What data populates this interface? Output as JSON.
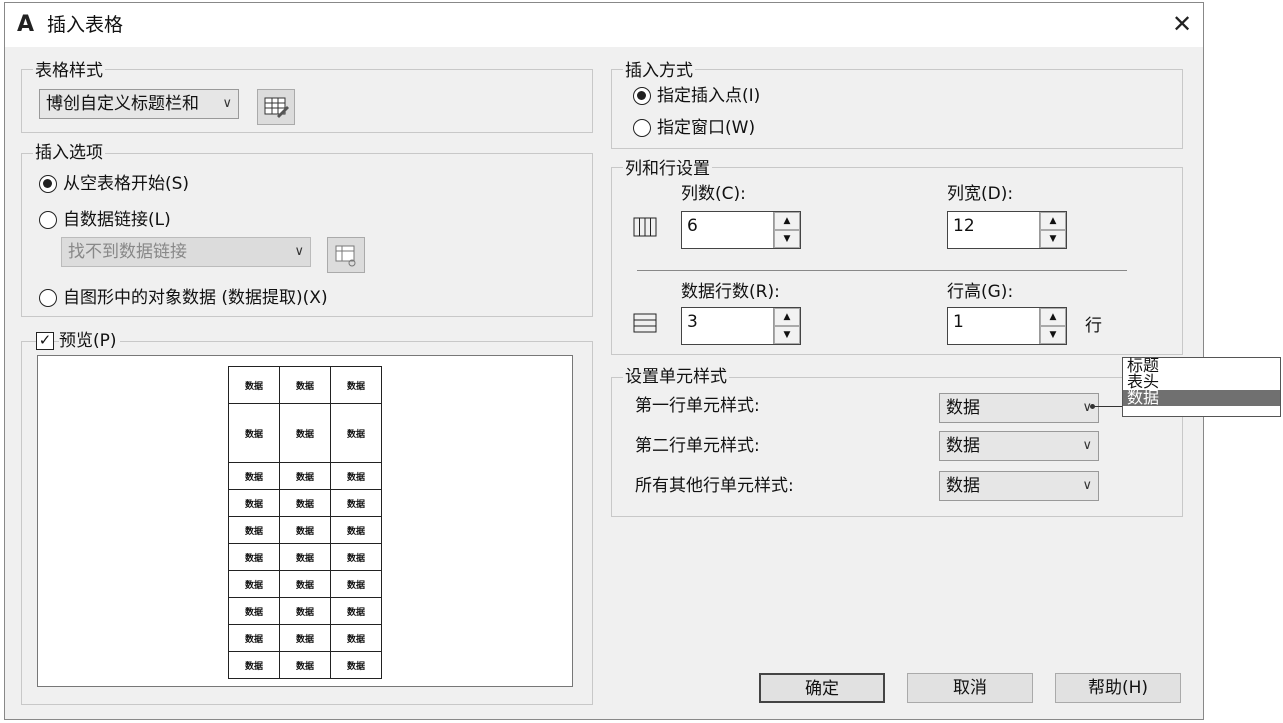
{
  "window": {
    "title": "插入表格",
    "close_glyph": "✕"
  },
  "table_style": {
    "label": "表格样式",
    "selected": "博创自定义标题栏和",
    "arrow": "∨"
  },
  "insert_options": {
    "label": "插入选项",
    "options": [
      {
        "label": "从空表格开始(S)",
        "selected": true
      },
      {
        "label": "自数据链接(L)",
        "selected": false
      },
      {
        "label": "自图形中的对象数据 (数据提取)(X)",
        "selected": false
      }
    ],
    "data_link_value": "找不到数据链接"
  },
  "preview": {
    "label": "预览(P)",
    "checked": true,
    "cell_text": "数据",
    "rows": 10,
    "cols": 3
  },
  "insert_method": {
    "label": "插入方式",
    "options": [
      {
        "label": "指定插入点(I)",
        "selected": true
      },
      {
        "label": "指定窗口(W)",
        "selected": false
      }
    ]
  },
  "col_row_settings": {
    "label": "列和行设置",
    "columns_label": "列数(C):",
    "columns_value": "6",
    "col_width_label": "列宽(D):",
    "col_width_value": "12",
    "data_rows_label": "数据行数(R):",
    "data_rows_value": "3",
    "row_height_label": "行高(G):",
    "row_height_value": "1",
    "row_unit": "行"
  },
  "cell_styles": {
    "label": "设置单元样式",
    "first_row_label": "第一行单元样式:",
    "first_row_value": "数据",
    "second_row_label": "第二行单元样式:",
    "second_row_value": "数据",
    "other_rows_label": "所有其他行单元样式:",
    "other_rows_value": "数据",
    "dropdown_options": [
      "标题",
      "表头",
      "数据"
    ],
    "dropdown_selected": "数据"
  },
  "buttons": {
    "ok": "确定",
    "cancel": "取消",
    "help": "帮助(H)"
  }
}
